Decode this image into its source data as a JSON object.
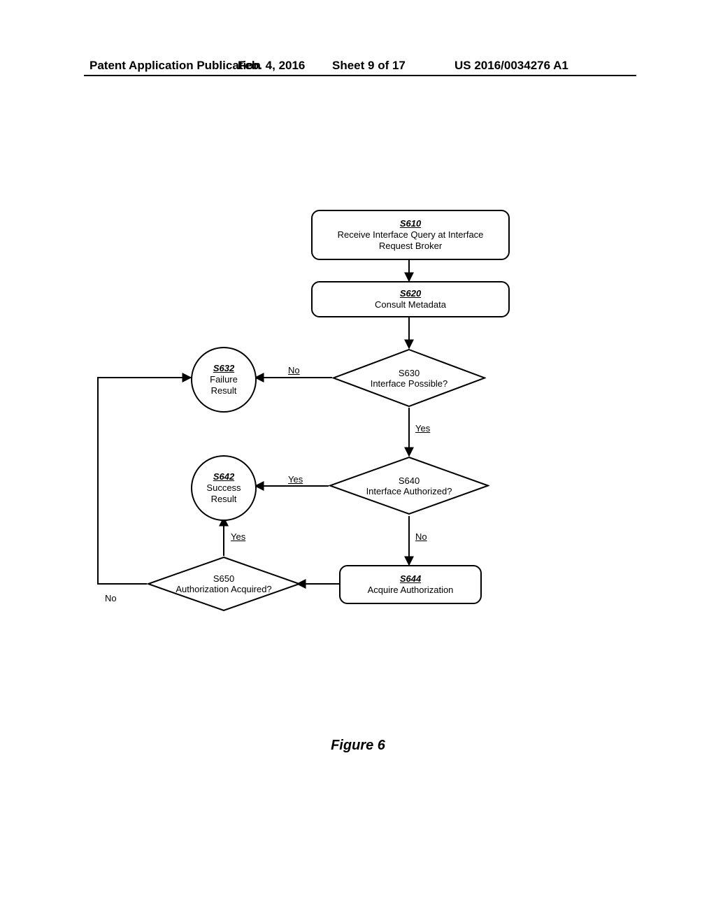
{
  "header": {
    "left": "Patent Application Publication",
    "date": "Feb. 4, 2016",
    "sheet": "Sheet 9 of 17",
    "pubno": "US 2016/0034276 A1"
  },
  "figure_label": "Figure 6",
  "nodes": {
    "s610": {
      "code": "S610",
      "text1": "Receive Interface Query at Interface",
      "text2": "Request Broker"
    },
    "s620": {
      "code": "S620",
      "text1": "Consult Metadata"
    },
    "s630": {
      "code": "S630",
      "text1": "Interface Possible?"
    },
    "s632": {
      "code": "S632",
      "text1": "Failure",
      "text2": "Result"
    },
    "s640": {
      "code": "S640",
      "text1": "Interface Authorized?"
    },
    "s642": {
      "code": "S642",
      "text1": "Success",
      "text2": "Result"
    },
    "s644": {
      "code": "S644",
      "text1": "Acquire Authorization"
    },
    "s650": {
      "code": "S650",
      "text1": "Authorization Acquired?"
    }
  },
  "edges": {
    "no1": "No",
    "yes1": "Yes",
    "no2": "No",
    "yes2": "Yes",
    "no3": "No",
    "yes3": "Yes"
  }
}
